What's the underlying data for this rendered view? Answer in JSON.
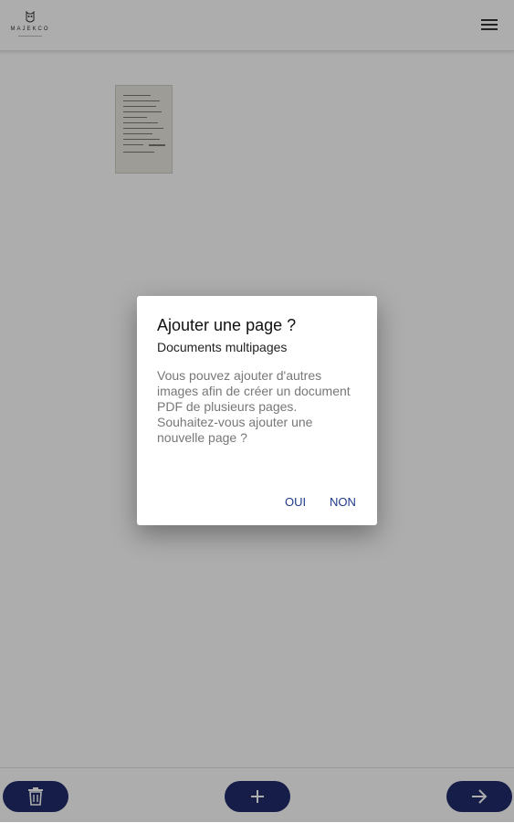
{
  "header": {
    "logo_text": "MAJEKCO",
    "logo_icon": "owl-logo-icon",
    "menu_icon": "hamburger-menu-icon"
  },
  "document": {
    "thumbnail_icon": "scanned-page-thumbnail"
  },
  "dialog": {
    "title": "Ajouter une page ?",
    "subtitle": "Documents multipages",
    "body_line1": "Vous pouvez ajouter d'autres images afin de créer un document PDF de plusieurs pages.",
    "body_line2": "Souhaitez-vous ajouter une nouvelle page ?",
    "yes_label": "OUI",
    "no_label": "NON"
  },
  "bottom_bar": {
    "delete_icon": "trash-icon",
    "add_icon": "plus-icon",
    "next_icon": "arrow-right-icon"
  },
  "colors": {
    "fab": "#1f2b6b",
    "dialog_button": "#1f3a8a",
    "scrim": "rgba(0,0,0,0.32)"
  }
}
